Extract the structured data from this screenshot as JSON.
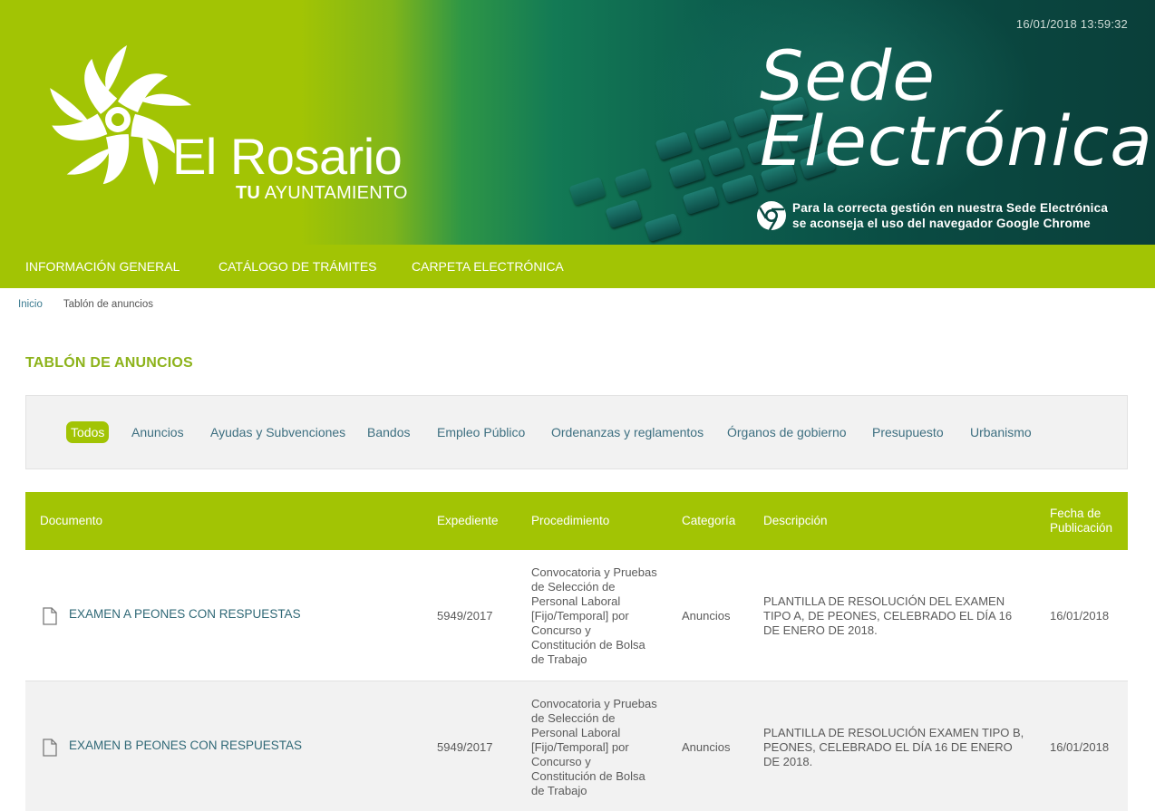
{
  "header": {
    "datetime": "16/01/2018 13:59:32",
    "logo_name": "El Rosario",
    "logo_tagline_bold": "TU",
    "logo_tagline_rest": " AYUNTAMIENTO",
    "sede_line1": "Sede",
    "sede_line2": "Electrónica",
    "chrome_line1": "Para la correcta gestión en nuestra Sede Electrónica",
    "chrome_line2": "se aconseja el uso del navegador Google Chrome"
  },
  "nav": {
    "items": [
      {
        "label": "INFORMACIÓN GENERAL"
      },
      {
        "label": "CATÁLOGO DE TRÁMITES"
      },
      {
        "label": "CARPETA ELECTRÓNICA"
      }
    ]
  },
  "breadcrumb": {
    "home": "Inicio",
    "current": "Tablón de anuncios"
  },
  "page": {
    "title": "TABLÓN DE ANUNCIOS"
  },
  "filters": {
    "items": [
      {
        "label": "Todos",
        "active": true
      },
      {
        "label": "Anuncios"
      },
      {
        "label": "Ayudas y Subvenciones"
      },
      {
        "label": "Bandos"
      },
      {
        "label": "Empleo Público"
      },
      {
        "label": "Ordenanzas y reglamentos"
      },
      {
        "label": "Órganos de gobierno"
      },
      {
        "label": "Presupuesto"
      },
      {
        "label": "Urbanismo"
      }
    ]
  },
  "table": {
    "columns": {
      "documento": "Documento",
      "expediente": "Expediente",
      "procedimiento": "Procedimiento",
      "categoria": "Categoría",
      "descripcion": "Descripción",
      "fecha_1": "Fecha de",
      "fecha_2": "Publicación"
    },
    "rows": [
      {
        "documento": "EXAMEN A PEONES CON RESPUESTAS",
        "expediente": "5949/2017",
        "procedimiento": "Convocatoria y Pruebas de Selección de Personal Laboral [Fijo/Temporal] por Concurso y Constitución de Bolsa de Trabajo",
        "categoria": "Anuncios",
        "descripcion": "PLANTILLA DE RESOLUCIÓN DEL EXAMEN TIPO A, DE PEONES, CELEBRADO EL DÍA 16 DE ENERO DE 2018.",
        "fecha": "16/01/2018"
      },
      {
        "documento": "EXAMEN B PEONES CON RESPUESTAS",
        "expediente": "5949/2017",
        "procedimiento": "Convocatoria y Pruebas de Selección de Personal Laboral [Fijo/Temporal] por Concurso y Constitución de Bolsa de Trabajo",
        "categoria": "Anuncios",
        "descripcion": "PLANTILLA DE RESOLUCIÓN EXAMEN TIPO B, PEONES, CELEBRADO EL DÍA 16 DE ENERO DE 2018.",
        "fecha": "16/01/2018"
      }
    ]
  },
  "colors": {
    "brand_green": "#a2c404",
    "title_green": "#8db31b",
    "link_teal": "#2f6876",
    "banner_dark": "#0a3f3a"
  }
}
